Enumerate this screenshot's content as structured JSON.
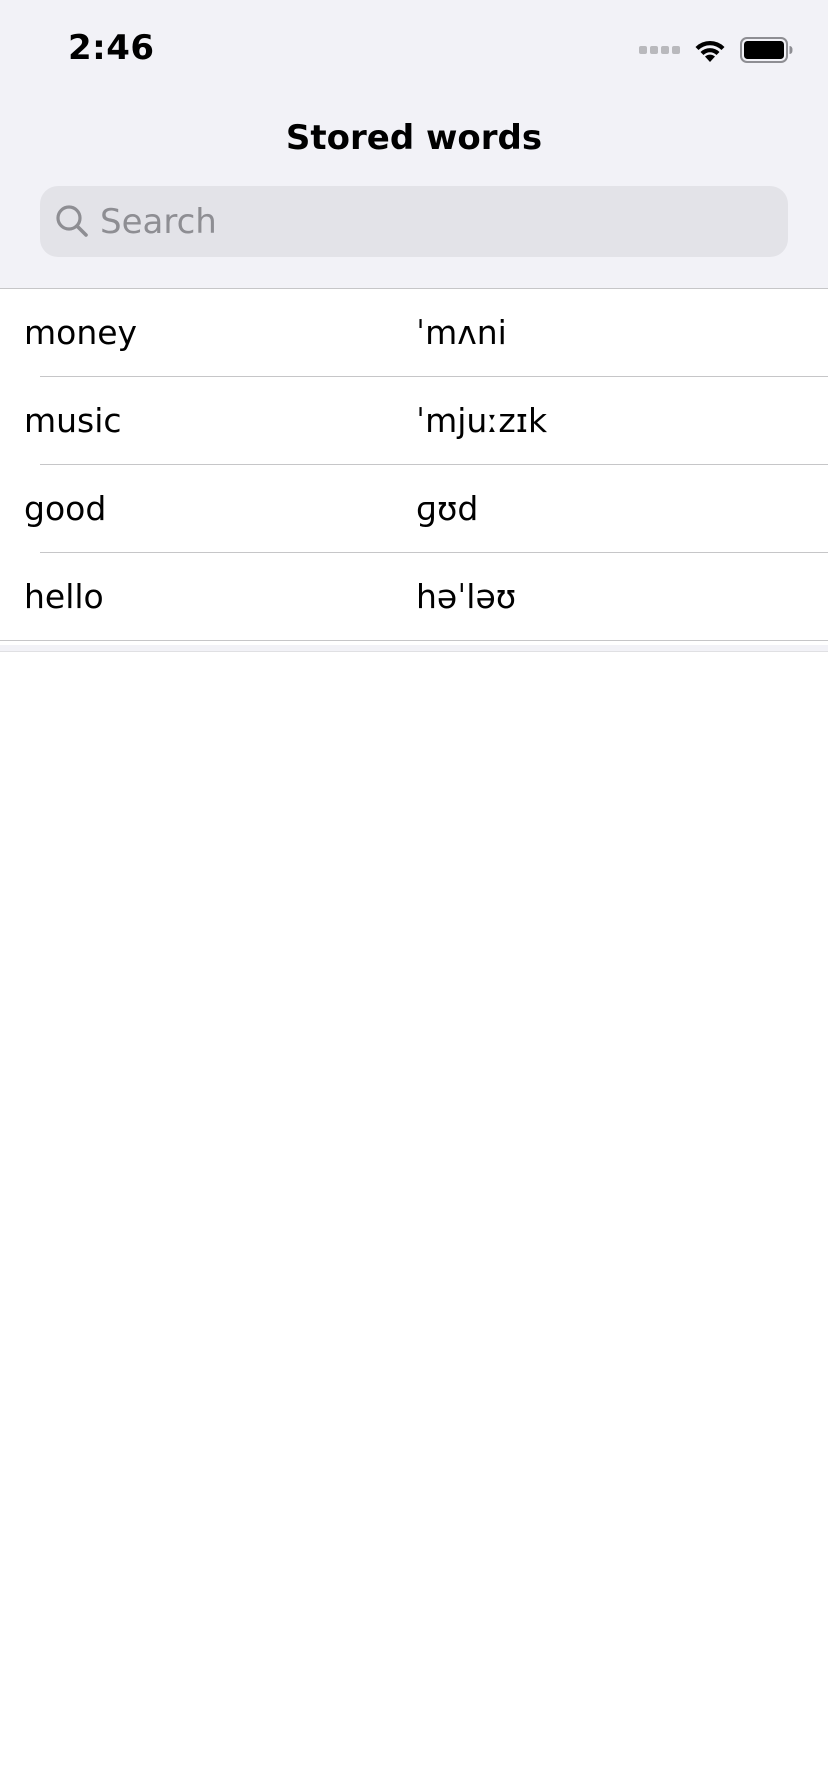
{
  "status_bar": {
    "time": "2:46"
  },
  "nav": {
    "title": "Stored words"
  },
  "search": {
    "placeholder": "Search",
    "value": ""
  },
  "words": [
    {
      "word": "money",
      "phonetic": "ˈmʌni"
    },
    {
      "word": "music",
      "phonetic": "ˈmjuːzɪk"
    },
    {
      "word": "good",
      "phonetic": "ɡʊd"
    },
    {
      "word": "hello",
      "phonetic": "həˈləʊ"
    }
  ],
  "icons": {
    "signal": "signal-icon",
    "wifi": "wifi-icon",
    "battery": "battery-icon",
    "search": "search-icon"
  },
  "colors": {
    "header_background": "#f2f2f7",
    "search_background": "#e3e3e8",
    "placeholder": "#8e8e93",
    "separator": "#c6c6c8"
  }
}
